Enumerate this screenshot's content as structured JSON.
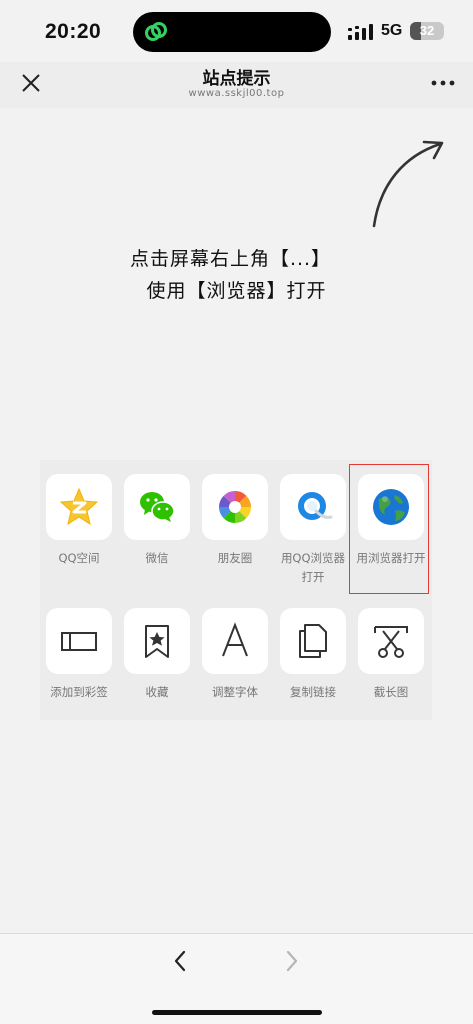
{
  "status_bar": {
    "time": "20:20",
    "network": "5G",
    "battery": "32",
    "battery_level": 0.32
  },
  "header": {
    "title": "站点提示",
    "url": "wwwa.sskjl00.top"
  },
  "hint": {
    "line1": "点击屏幕右上角【...】",
    "line2": "使用【浏览器】打开"
  },
  "share_panel": {
    "row1": [
      {
        "label": "QQ空间",
        "icon": "qzone-icon"
      },
      {
        "label": "微信",
        "icon": "wechat-icon"
      },
      {
        "label": "朋友圈",
        "icon": "moments-icon"
      },
      {
        "label": "用QQ浏览器打开",
        "icon": "qq-browser-icon"
      },
      {
        "label": "用浏览器打开",
        "icon": "globe-icon"
      }
    ],
    "row2": [
      {
        "label": "添加到彩签",
        "icon": "sticky-note-icon"
      },
      {
        "label": "收藏",
        "icon": "bookmark-star-icon"
      },
      {
        "label": "调整字体",
        "icon": "font-icon"
      },
      {
        "label": "复制链接",
        "icon": "copy-icon"
      },
      {
        "label": "截长图",
        "icon": "scissors-icon"
      }
    ]
  },
  "colors": {
    "highlight": "#e53935",
    "wechat_green": "#2dc100",
    "qzone_yellow": "#f7c531"
  }
}
